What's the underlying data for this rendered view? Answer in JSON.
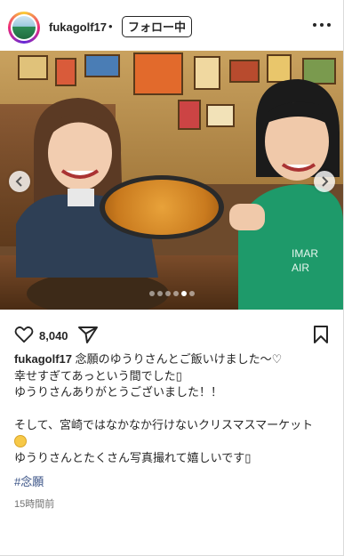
{
  "header": {
    "username": "fukagolf17",
    "separator": "•",
    "follow_label": "フォロー中",
    "more_icon": "more-horizontal-icon"
  },
  "carousel": {
    "slide_count": 6,
    "active_index": 4,
    "prev_icon": "chevron-left-icon",
    "next_icon": "chevron-right-icon"
  },
  "actions": {
    "like_icon": "heart-icon",
    "like_count": "8,040",
    "share_icon": "paper-plane-icon",
    "save_icon": "bookmark-icon"
  },
  "caption": {
    "username": "fukagolf17",
    "line1": " 念願のゆうりさんとご飯いけました～♡",
    "line2": "幸せすぎてあっという間でした▯",
    "line3": "ゆうりさんありがとうございました！！",
    "line4": "そして、宮崎ではなかなか行けないクリスマスマーケット",
    "line5": "ゆうりさんとたくさん写真撮れて嬉しいです▯"
  },
  "hashtag": "#念願",
  "timestamp": "15時間前"
}
